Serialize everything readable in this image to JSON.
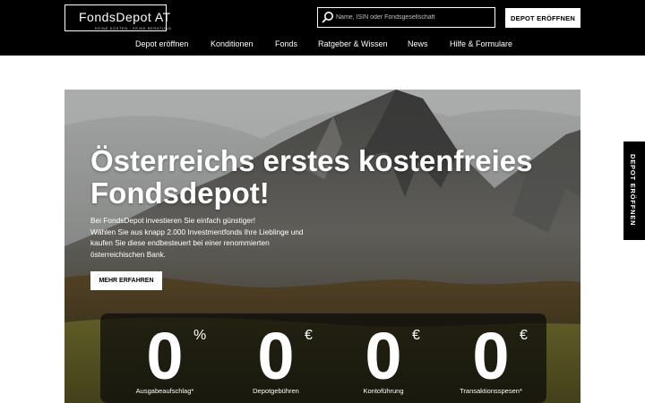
{
  "header": {
    "logo_title": "FondsDepot AT",
    "logo_tagline": "KEINE KOSTEN · KEINE BERATUNG",
    "search_placeholder": "Name, ISIN oder Fondsgesellschaft",
    "search_value": "",
    "search_icon": "search-icon",
    "cta_label": "DEPOT ERÖFFNEN"
  },
  "nav": {
    "items": [
      {
        "label": "Depot eröffnen"
      },
      {
        "label": "Konditionen"
      },
      {
        "label": "Fonds"
      },
      {
        "label": "Ratgeber & Wissen"
      },
      {
        "label": "News"
      },
      {
        "label": "Hilfe & Formulare"
      }
    ]
  },
  "hero": {
    "title": "Österreichs erstes kostenfreies Fondsdepot!",
    "lines": [
      "Bei FondsDepot investieren Sie einfach günstiger!",
      "Wählen Sie aus knapp 2.000 Investmentfonds Ihre Lieblinge und",
      "kaufen Sie diese endbesteuert bei einer renommierten",
      "österreichischen Bank."
    ],
    "button_label": "MEHR ERFAHREN"
  },
  "stats": [
    {
      "value": "0",
      "unit": "%",
      "label": "Ausgabeaufschlag*"
    },
    {
      "value": "0",
      "unit": "€",
      "label": "Depotgebühren"
    },
    {
      "value": "0",
      "unit": "€",
      "label": "Kontoführung"
    },
    {
      "value": "0",
      "unit": "€",
      "label": "Transaktionsspesen*"
    }
  ],
  "side_tab": {
    "label": "DEPOT ERÖFFNEN"
  },
  "colors": {
    "header_bg": "#000000",
    "accent": "#ffffff",
    "page_bg": "#ffffff"
  }
}
